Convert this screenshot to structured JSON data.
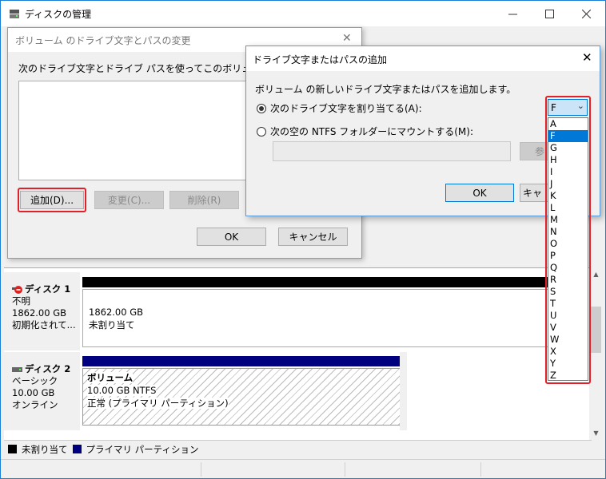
{
  "main_window": {
    "title": "ディスクの管理"
  },
  "disk1": {
    "name": "ディスク 1",
    "status": "不明",
    "size": "1862.00 GB",
    "state": "初期化されて...",
    "partition_size": "1862.00 GB",
    "partition_status": "未割り当て"
  },
  "disk2": {
    "name": "ディスク 2",
    "type": "ベーシック",
    "size": "10.00 GB",
    "state": "オンライン",
    "partition_name": "ボリューム",
    "partition_detail": "10.00 GB NTFS",
    "partition_status": "正常 (プライマリ パーティション)"
  },
  "legend": {
    "unallocated": "未割り当て",
    "primary": "プライマリ パーティション",
    "colors": {
      "unallocated": "#000000",
      "primary": "#00007f"
    }
  },
  "dialog1": {
    "title": "ボリューム のドライブ文字とパスの変更",
    "description": "次のドライブ文字とドライブ パスを使ってこのボリュームにアクセスします",
    "add_label": "追加(D)...",
    "change_label": "変更(C)...",
    "remove_label": "削除(R)",
    "ok_label": "OK",
    "cancel_label": "キャンセル"
  },
  "dialog2": {
    "title": "ドライブ文字またはパスの追加",
    "description": "ボリューム の新しいドライブ文字またはパスを追加します。",
    "assign_letter_label": "次のドライブ文字を割り当てる(A):",
    "mount_folder_label": "次の空の NTFS フォルダーにマウントする(M):",
    "browse_label": "参",
    "ok_label": "OK",
    "cancel_label": "キャ"
  },
  "drive_select": {
    "selected": "F",
    "options": [
      "A",
      "F",
      "G",
      "H",
      "I",
      "J",
      "K",
      "L",
      "M",
      "N",
      "O",
      "P",
      "Q",
      "R",
      "S",
      "T",
      "U",
      "V",
      "W",
      "X",
      "Y",
      "Z"
    ]
  },
  "accent": {
    "highlight": "#e1202a",
    "selection": "#0078d7"
  }
}
